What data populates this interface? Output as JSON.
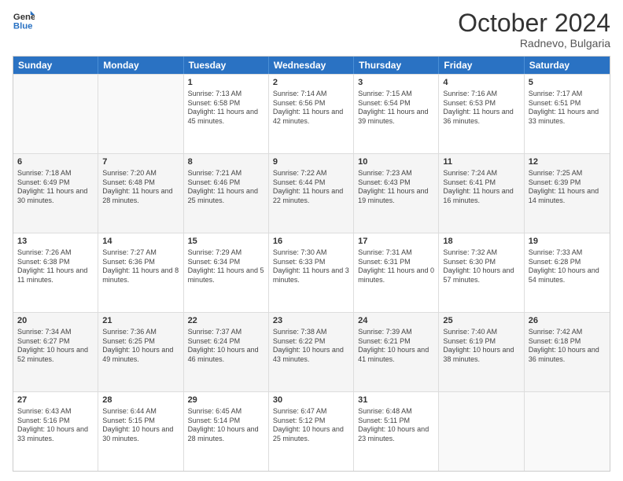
{
  "logo": {
    "line1": "General",
    "line2": "Blue"
  },
  "title": "October 2024",
  "location": "Radnevo, Bulgaria",
  "days_of_week": [
    "Sunday",
    "Monday",
    "Tuesday",
    "Wednesday",
    "Thursday",
    "Friday",
    "Saturday"
  ],
  "weeks": [
    [
      {
        "day": "",
        "info": ""
      },
      {
        "day": "",
        "info": ""
      },
      {
        "day": "1",
        "info": "Sunrise: 7:13 AM\nSunset: 6:58 PM\nDaylight: 11 hours and 45 minutes."
      },
      {
        "day": "2",
        "info": "Sunrise: 7:14 AM\nSunset: 6:56 PM\nDaylight: 11 hours and 42 minutes."
      },
      {
        "day": "3",
        "info": "Sunrise: 7:15 AM\nSunset: 6:54 PM\nDaylight: 11 hours and 39 minutes."
      },
      {
        "day": "4",
        "info": "Sunrise: 7:16 AM\nSunset: 6:53 PM\nDaylight: 11 hours and 36 minutes."
      },
      {
        "day": "5",
        "info": "Sunrise: 7:17 AM\nSunset: 6:51 PM\nDaylight: 11 hours and 33 minutes."
      }
    ],
    [
      {
        "day": "6",
        "info": "Sunrise: 7:18 AM\nSunset: 6:49 PM\nDaylight: 11 hours and 30 minutes."
      },
      {
        "day": "7",
        "info": "Sunrise: 7:20 AM\nSunset: 6:48 PM\nDaylight: 11 hours and 28 minutes."
      },
      {
        "day": "8",
        "info": "Sunrise: 7:21 AM\nSunset: 6:46 PM\nDaylight: 11 hours and 25 minutes."
      },
      {
        "day": "9",
        "info": "Sunrise: 7:22 AM\nSunset: 6:44 PM\nDaylight: 11 hours and 22 minutes."
      },
      {
        "day": "10",
        "info": "Sunrise: 7:23 AM\nSunset: 6:43 PM\nDaylight: 11 hours and 19 minutes."
      },
      {
        "day": "11",
        "info": "Sunrise: 7:24 AM\nSunset: 6:41 PM\nDaylight: 11 hours and 16 minutes."
      },
      {
        "day": "12",
        "info": "Sunrise: 7:25 AM\nSunset: 6:39 PM\nDaylight: 11 hours and 14 minutes."
      }
    ],
    [
      {
        "day": "13",
        "info": "Sunrise: 7:26 AM\nSunset: 6:38 PM\nDaylight: 11 hours and 11 minutes."
      },
      {
        "day": "14",
        "info": "Sunrise: 7:27 AM\nSunset: 6:36 PM\nDaylight: 11 hours and 8 minutes."
      },
      {
        "day": "15",
        "info": "Sunrise: 7:29 AM\nSunset: 6:34 PM\nDaylight: 11 hours and 5 minutes."
      },
      {
        "day": "16",
        "info": "Sunrise: 7:30 AM\nSunset: 6:33 PM\nDaylight: 11 hours and 3 minutes."
      },
      {
        "day": "17",
        "info": "Sunrise: 7:31 AM\nSunset: 6:31 PM\nDaylight: 11 hours and 0 minutes."
      },
      {
        "day": "18",
        "info": "Sunrise: 7:32 AM\nSunset: 6:30 PM\nDaylight: 10 hours and 57 minutes."
      },
      {
        "day": "19",
        "info": "Sunrise: 7:33 AM\nSunset: 6:28 PM\nDaylight: 10 hours and 54 minutes."
      }
    ],
    [
      {
        "day": "20",
        "info": "Sunrise: 7:34 AM\nSunset: 6:27 PM\nDaylight: 10 hours and 52 minutes."
      },
      {
        "day": "21",
        "info": "Sunrise: 7:36 AM\nSunset: 6:25 PM\nDaylight: 10 hours and 49 minutes."
      },
      {
        "day": "22",
        "info": "Sunrise: 7:37 AM\nSunset: 6:24 PM\nDaylight: 10 hours and 46 minutes."
      },
      {
        "day": "23",
        "info": "Sunrise: 7:38 AM\nSunset: 6:22 PM\nDaylight: 10 hours and 43 minutes."
      },
      {
        "day": "24",
        "info": "Sunrise: 7:39 AM\nSunset: 6:21 PM\nDaylight: 10 hours and 41 minutes."
      },
      {
        "day": "25",
        "info": "Sunrise: 7:40 AM\nSunset: 6:19 PM\nDaylight: 10 hours and 38 minutes."
      },
      {
        "day": "26",
        "info": "Sunrise: 7:42 AM\nSunset: 6:18 PM\nDaylight: 10 hours and 36 minutes."
      }
    ],
    [
      {
        "day": "27",
        "info": "Sunrise: 6:43 AM\nSunset: 5:16 PM\nDaylight: 10 hours and 33 minutes."
      },
      {
        "day": "28",
        "info": "Sunrise: 6:44 AM\nSunset: 5:15 PM\nDaylight: 10 hours and 30 minutes."
      },
      {
        "day": "29",
        "info": "Sunrise: 6:45 AM\nSunset: 5:14 PM\nDaylight: 10 hours and 28 minutes."
      },
      {
        "day": "30",
        "info": "Sunrise: 6:47 AM\nSunset: 5:12 PM\nDaylight: 10 hours and 25 minutes."
      },
      {
        "day": "31",
        "info": "Sunrise: 6:48 AM\nSunset: 5:11 PM\nDaylight: 10 hours and 23 minutes."
      },
      {
        "day": "",
        "info": ""
      },
      {
        "day": "",
        "info": ""
      }
    ]
  ]
}
